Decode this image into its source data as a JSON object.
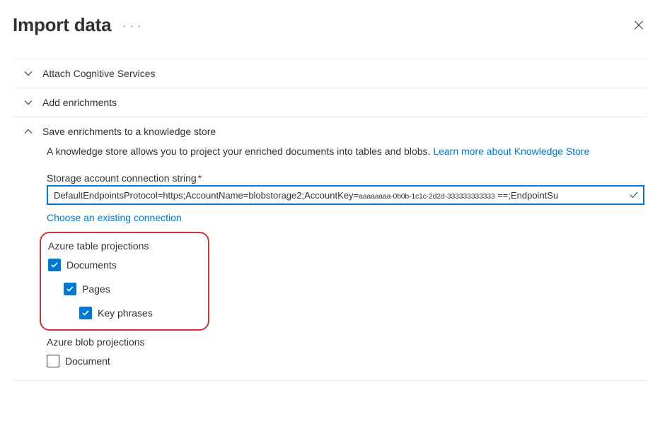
{
  "header": {
    "title": "Import data"
  },
  "sections": {
    "attach": {
      "title": "Attach Cognitive Services"
    },
    "enrich": {
      "title": "Add enrichments"
    },
    "save": {
      "title": "Save enrichments to a knowledge store",
      "description": "A knowledge store allows you to project your enriched documents into tables and blobs.",
      "learn_more": "Learn more about Knowledge Store",
      "conn_label": "Storage account connection string",
      "conn_value_pre": "DefaultEndpointsProtocol=https;AccountName=blobstorage2;AccountKey=",
      "conn_value_redact": "aaaaaaaa-0b0b-1c1c-2d2d-333333333333",
      "conn_value_post": " ==;EndpointSu",
      "existing_link": "Choose an existing connection",
      "table_proj_heading": "Azure table projections",
      "cb_documents": "Documents",
      "cb_pages": "Pages",
      "cb_keyphrases": "Key phrases",
      "blob_proj_heading": "Azure blob projections",
      "cb_document": "Document"
    }
  }
}
